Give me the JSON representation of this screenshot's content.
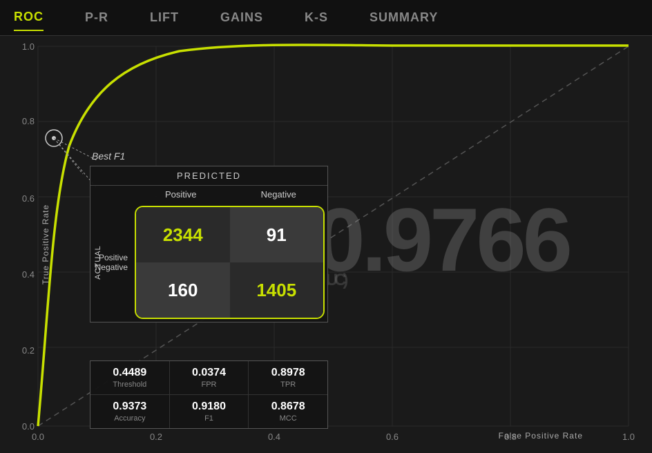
{
  "nav": {
    "tabs": [
      {
        "label": "ROC",
        "active": true
      },
      {
        "label": "P-R",
        "active": false
      },
      {
        "label": "LIFT",
        "active": false
      },
      {
        "label": "GAINS",
        "active": false
      },
      {
        "label": "K-S",
        "active": false
      },
      {
        "label": "SUMMARY",
        "active": false
      }
    ]
  },
  "chart": {
    "x_axis_ticks": [
      "0.0",
      "0.2",
      "0.4",
      "0.6",
      "0.8",
      "1.0"
    ],
    "y_axis_ticks": [
      "0.0",
      "0.2",
      "0.4",
      "0.6",
      "0.8",
      "1.0"
    ],
    "y_axis_label": "True Positive Rate",
    "x_axis_label": "False Positive Rate",
    "auc_display": "0.9766",
    "auc_label": "(AUC)"
  },
  "best_f1_label": "Best F1",
  "confusion_matrix": {
    "predicted_header": "PREDICTED",
    "col_positive": "Positive",
    "col_negative": "Negative",
    "row_actual": "ACTUAL",
    "row_positive": "Positive",
    "row_negative": "Negative",
    "tp": "2344",
    "fn": "91",
    "fp": "160",
    "tn": "1405"
  },
  "stats": {
    "row1": [
      {
        "value": "0.4489",
        "label": "Threshold"
      },
      {
        "value": "0.0374",
        "label": "FPR"
      },
      {
        "value": "0.8978",
        "label": "TPR"
      }
    ],
    "row2": [
      {
        "value": "0.9373",
        "label": "Accuracy"
      },
      {
        "value": "0.9180",
        "label": "F1"
      },
      {
        "value": "0.8678",
        "label": "MCC"
      }
    ]
  },
  "roc_corner": "0.0"
}
